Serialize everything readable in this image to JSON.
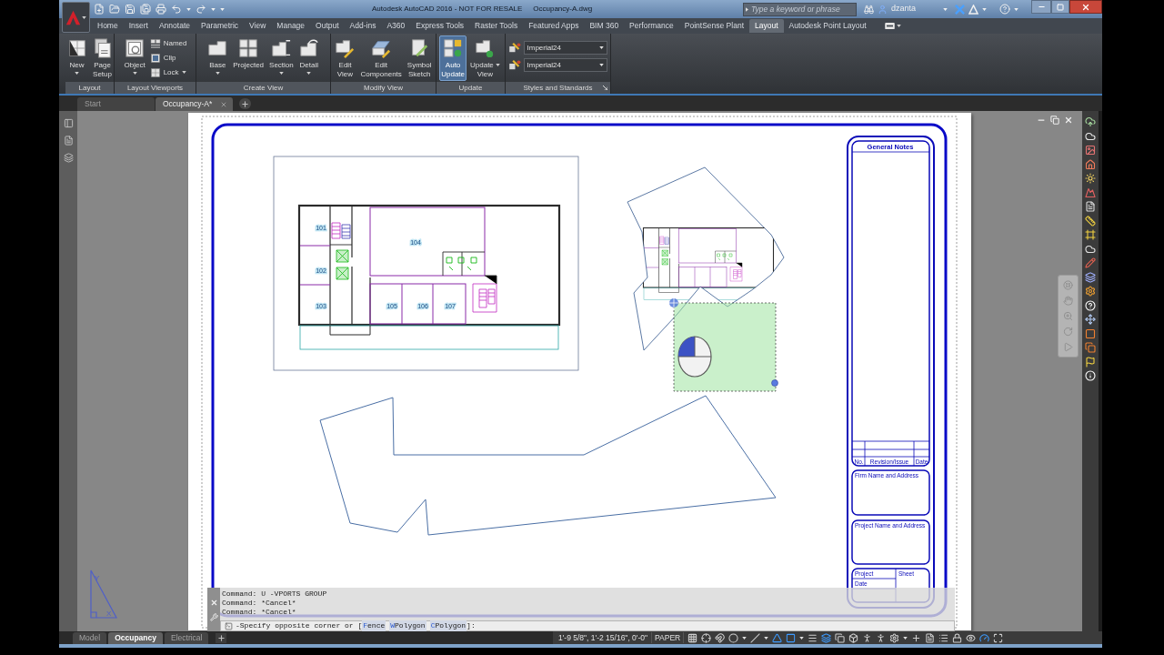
{
  "title_bar": {
    "app_title": "Autodesk AutoCAD 2016 - NOT FOR RESALE",
    "file_name": "Occupancy-A.dwg",
    "search": {
      "placeholder": "Type a keyword or phrase"
    },
    "user_name": "dzanta"
  },
  "ribbon_tabs": [
    {
      "label": "Home",
      "selected": false
    },
    {
      "label": "Insert",
      "selected": false
    },
    {
      "label": "Annotate",
      "selected": false
    },
    {
      "label": "Parametric",
      "selected": false
    },
    {
      "label": "View",
      "selected": false
    },
    {
      "label": "Manage",
      "selected": false
    },
    {
      "label": "Output",
      "selected": false
    },
    {
      "label": "Add-ins",
      "selected": false
    },
    {
      "label": "A360",
      "selected": false
    },
    {
      "label": "Express Tools",
      "selected": false
    },
    {
      "label": "Raster Tools",
      "selected": false
    },
    {
      "label": "Featured Apps",
      "selected": false
    },
    {
      "label": "BIM 360",
      "selected": false
    },
    {
      "label": "Performance",
      "selected": false
    },
    {
      "label": "PointSense Plant",
      "selected": false
    },
    {
      "label": "Layout",
      "selected": true
    },
    {
      "label": "Autodesk Point Layout",
      "selected": false
    }
  ],
  "ribbon_panels": [
    {
      "title": "Layout",
      "launcher": false,
      "tools": [
        {
          "kind": "large",
          "label_lines": [
            "New"
          ],
          "dropdown": true,
          "on": false
        },
        {
          "kind": "large",
          "label_lines": [
            "Page",
            "Setup"
          ],
          "dropdown": false,
          "on": false
        }
      ]
    },
    {
      "title": "Layout Viewports",
      "launcher": false,
      "tools": [
        {
          "kind": "large",
          "label_lines": [
            "Object"
          ],
          "dropdown": true,
          "on": false
        },
        {
          "kind": "small",
          "label": "Named",
          "dropdown": false
        },
        {
          "kind": "small",
          "label": "Clip",
          "dropdown": false
        },
        {
          "kind": "small",
          "label": "Lock",
          "dropdown": true
        }
      ]
    },
    {
      "title": "Create View",
      "launcher": false,
      "tools": [
        {
          "kind": "large",
          "label_lines": [
            "Base"
          ],
          "dropdown": true,
          "on": false
        },
        {
          "kind": "large",
          "label_lines": [
            "Projected"
          ],
          "dropdown": false,
          "on": false
        },
        {
          "kind": "large",
          "label_lines": [
            "Section"
          ],
          "dropdown": true,
          "on": false
        },
        {
          "kind": "large",
          "label_lines": [
            "Detail"
          ],
          "dropdown": true,
          "on": false
        }
      ]
    },
    {
      "title": "Modify View",
      "launcher": false,
      "tools": [
        {
          "kind": "large",
          "label_lines": [
            "Edit",
            "View"
          ],
          "dropdown": false,
          "on": false
        },
        {
          "kind": "large",
          "label_lines": [
            "Edit",
            "Components"
          ],
          "dropdown": false,
          "on": false
        },
        {
          "kind": "large",
          "label_lines": [
            "Symbol",
            "Sketch"
          ],
          "dropdown": false,
          "on": false
        }
      ]
    },
    {
      "title": "Update",
      "launcher": false,
      "tools": [
        {
          "kind": "large",
          "label_lines": [
            "Auto",
            "Update"
          ],
          "dropdown": false,
          "on": true
        },
        {
          "kind": "large",
          "label_lines": [
            "Update",
            "View"
          ],
          "dropdown": true,
          "on": false
        }
      ]
    },
    {
      "title": "Styles and Standards",
      "launcher": true,
      "tools": [
        {
          "kind": "combo",
          "value": "Imperial24"
        },
        {
          "kind": "combo",
          "value": "Imperial24"
        }
      ]
    }
  ],
  "document_tabs": [
    {
      "label": "Start",
      "selected": false
    },
    {
      "label": "Occupancy-A*",
      "selected": true
    }
  ],
  "sheet": {
    "floor_plan": {
      "room_labels": [
        "101",
        "102",
        "103",
        "104",
        "105",
        "106",
        "107"
      ]
    },
    "title_block": {
      "header": "General Notes",
      "revision_columns": [
        "No.",
        "Revision/Issue",
        "Date"
      ],
      "box_labels": [
        "Firm Name and Address",
        "Project Name and Address"
      ],
      "fields": [
        "Project",
        "Sheet",
        "Date"
      ]
    }
  },
  "ucs_labels": [
    "Y",
    "X"
  ],
  "command_line": {
    "history": [
      "Command: U -VPORTS GROUP",
      "Command: *Cancel*",
      "Command: *Cancel*"
    ],
    "prompt": {
      "text": "-Specify opposite corner or [",
      "options": [
        {
          "hotkey": "F",
          "rest": "ence"
        },
        {
          "hotkey": "W",
          "rest": "Polygon"
        },
        {
          "hotkey": "C",
          "rest": "Polygon"
        }
      ],
      "end": "]:"
    }
  },
  "layout_tabs": [
    {
      "label": "Model",
      "selected": false
    },
    {
      "label": "Occupancy",
      "selected": true
    },
    {
      "label": "Electrical",
      "selected": false
    }
  ],
  "status_bar": {
    "coordinates": "1'-9 5/8\", 1'-2 15/16\", 0'-0\"",
    "space": "PAPER",
    "toggles": [
      {
        "on": false,
        "dropdown": false
      },
      {
        "on": false,
        "dropdown": false
      },
      {
        "on": false,
        "dropdown": false
      },
      {
        "on": false,
        "dropdown": true
      },
      {
        "on": false,
        "dropdown": true
      },
      {
        "on": true,
        "dropdown": false
      },
      {
        "on": true,
        "dropdown": true
      },
      {
        "on": false,
        "dropdown": false
      },
      {
        "on": true,
        "dropdown": false
      },
      {
        "on": false,
        "dropdown": false
      },
      {
        "on": false,
        "dropdown": false
      },
      {
        "on": false,
        "dropdown": false
      },
      {
        "on": false,
        "dropdown": false
      },
      {
        "on": false,
        "dropdown": true
      },
      {
        "on": false,
        "dropdown": false
      },
      {
        "on": false,
        "dropdown": false
      },
      {
        "on": false,
        "dropdown": false
      },
      {
        "on": false,
        "dropdown": false
      },
      {
        "on": false,
        "dropdown": false
      },
      {
        "on": true,
        "dropdown": false
      },
      {
        "on": false,
        "dropdown": false
      }
    ]
  }
}
